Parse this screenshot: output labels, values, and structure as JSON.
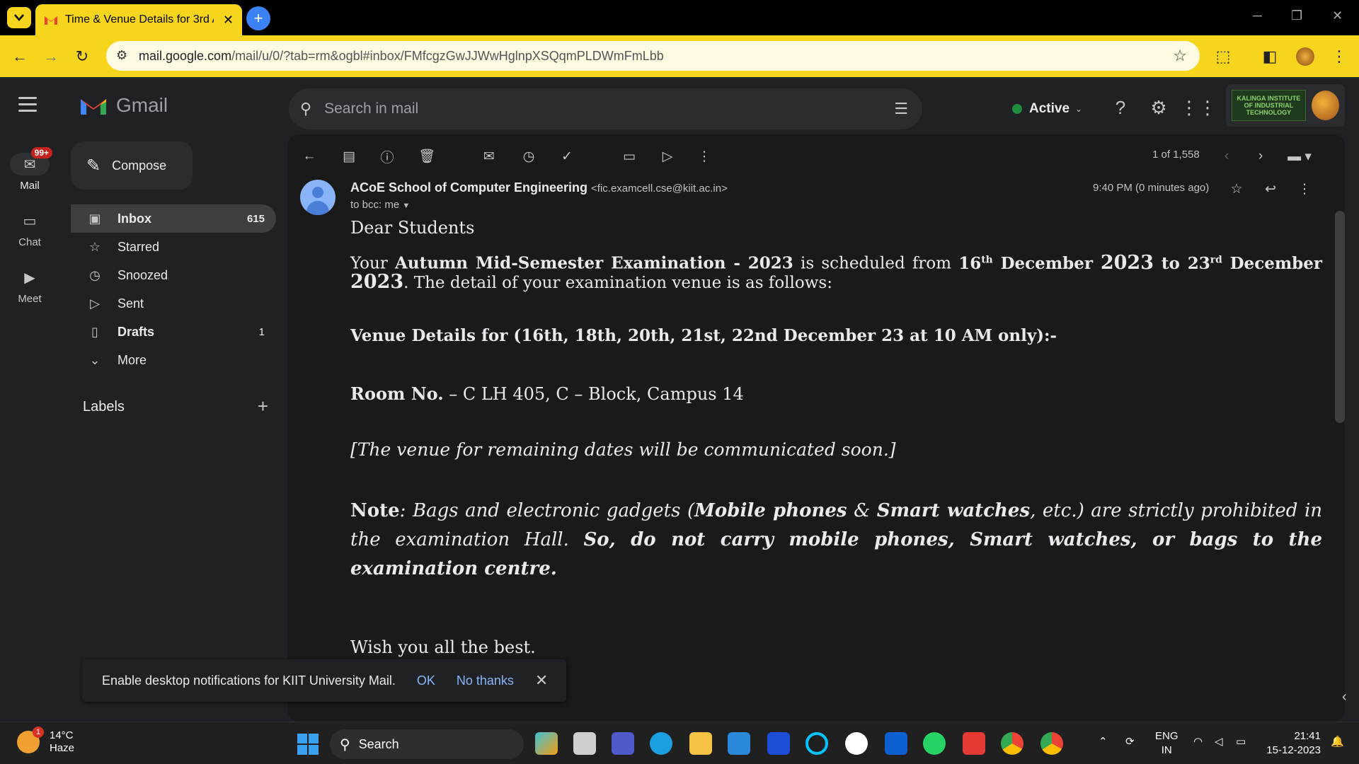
{
  "browser": {
    "tab_title": "Time & Venue Details for 3rd A",
    "url_host": "mail.google.com",
    "url_path": "/mail/u/0/?tab=rm&ogbl#inbox/FMfcgzGwJJWwHglnpXSQqmPLDWmFmLbb"
  },
  "gmail": {
    "logo_text": "Gmail",
    "search_placeholder": "Search in mail",
    "status": "Active",
    "account_logo_text": "KALINGA INSTITUTE OF INDUSTRIAL TECHNOLOGY"
  },
  "rail": [
    {
      "label": "Mail",
      "badge": "99+"
    },
    {
      "label": "Chat"
    },
    {
      "label": "Meet"
    }
  ],
  "nav": {
    "compose": "Compose",
    "items": [
      {
        "label": "Inbox",
        "count": "615",
        "icon": "inbox-icon"
      },
      {
        "label": "Starred",
        "count": "",
        "icon": "star-icon"
      },
      {
        "label": "Snoozed",
        "count": "",
        "icon": "clock-icon"
      },
      {
        "label": "Sent",
        "count": "",
        "icon": "send-icon"
      },
      {
        "label": "Drafts",
        "count": "1",
        "icon": "draft-icon"
      },
      {
        "label": "More",
        "count": "",
        "icon": "chevron-down-icon"
      }
    ],
    "labels_heading": "Labels"
  },
  "message": {
    "pager": "1 of 1,558",
    "sender_name": "ACoE School of Computer Engineering",
    "sender_email": "<fic.examcell.cse@kiit.ac.in>",
    "to": "to bcc: me",
    "time": "9:40 PM (0 minutes ago)",
    "body": {
      "greeting": "Dear Students",
      "p2_a": "Your ",
      "p2_exam": "Autumn Mid-Semester Examination - 2023",
      "p2_b": " is scheduled from ",
      "p2_from_day": "16",
      "p2_from_sup": "th",
      "p2_from_month": " December ",
      "p2_year1": "2023",
      "p2_to": " to ",
      "p2_to_day": "23",
      "p2_to_sup": "rd",
      "p2_to_month": " December ",
      "p2_year2": "2023",
      "p2_c": ". The detail of your examination venue is as follows:",
      "venue_head": "Venue Details for (16th, 18th, 20th, 21st, 22nd December 23 at 10 AM only):-",
      "room_label": "Room No.",
      "room_value": " – C LH 405, C – Block, Campus 14",
      "remaining": "[The venue for remaining dates will be communicated soon.]",
      "note_label": "Note",
      "note_a": ": Bags and electronic gadgets (",
      "note_mobile": "Mobile phones",
      "note_amp": " & ",
      "note_watch": "Smart watches",
      "note_b": ", etc.) are strictly prohibited in the examination Hall. ",
      "note_c": "So, do not carry mobile phones, Smart watches, or bags to the examination centre.",
      "closing": "Wish you all the best."
    }
  },
  "notification": {
    "text": "Enable desktop notifications for KIIT University Mail.",
    "ok": "OK",
    "no_thanks": "No thanks"
  },
  "taskbar": {
    "weather_temp": "14°C",
    "weather_desc": "Haze",
    "weather_badge": "1",
    "search": "Search",
    "lang1": "ENG",
    "lang2": "IN",
    "time": "21:41",
    "date": "15-12-2023"
  }
}
